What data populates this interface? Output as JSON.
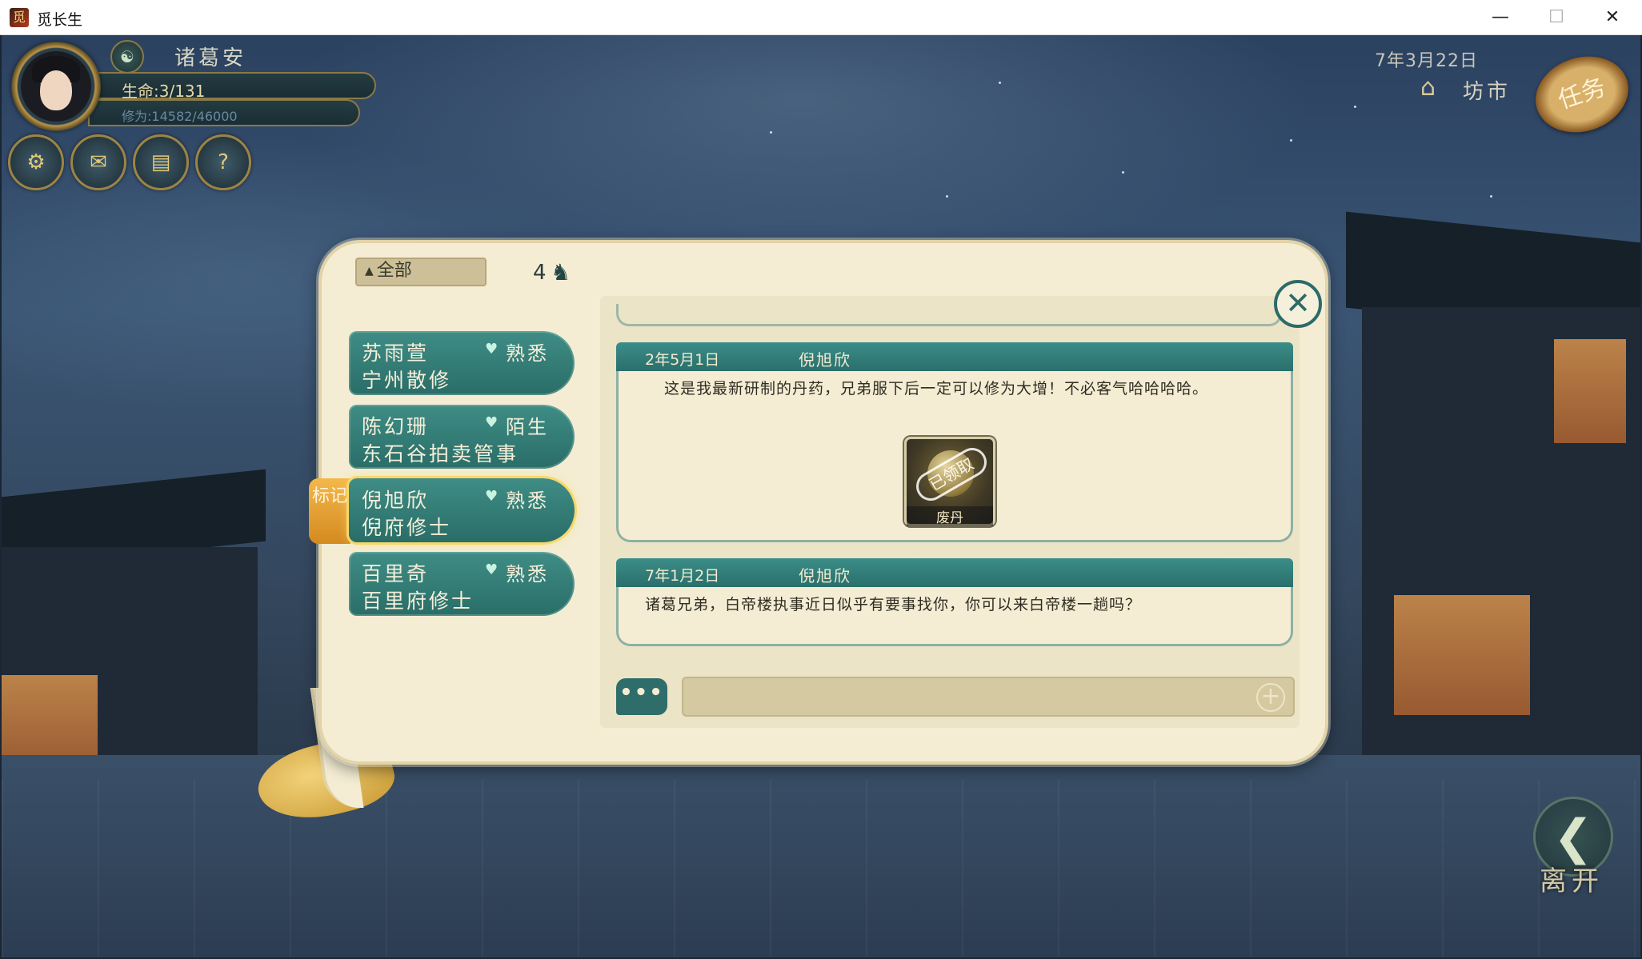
{
  "window": {
    "title": "觅长生",
    "app_icon_glyph": "觅",
    "minimize": "—",
    "maximize": "☐",
    "close": "✕"
  },
  "hud": {
    "player_name": "诸葛安",
    "dao_icon": "☯",
    "life_label": "生命",
    "life_value": ":3/131",
    "cultivation_label": "修为",
    "cultivation_value": ":14582/46000",
    "menu_icons": [
      "compass-icon",
      "scroll-icon",
      "map-icon",
      "hint-icon"
    ],
    "menu_glyphs": [
      "⚙",
      "✉",
      "▤",
      "?"
    ]
  },
  "top_right": {
    "date": "7年3月22日",
    "location_icon": "⌂",
    "location": "坊市",
    "task_button": "任务"
  },
  "leave": {
    "icon": "❮",
    "label": "离开"
  },
  "dialog": {
    "filter_label": "全部",
    "filter_arrow": "▲",
    "friend_count": "4",
    "friend_icon": "♞",
    "mark_tab": "标记",
    "close_glyph": "✕",
    "contacts": [
      {
        "name": "苏雨萱",
        "title": "宁州散修",
        "relation": "熟悉",
        "heart": "♥"
      },
      {
        "name": "陈幻珊",
        "title": "东石谷拍卖管事",
        "relation": "陌生",
        "heart": "♥"
      },
      {
        "name": "倪旭欣",
        "title": "倪府修士",
        "relation": "熟悉",
        "heart": "♥"
      },
      {
        "name": "百里奇",
        "title": "百里府修士",
        "relation": "熟悉",
        "heart": "♥"
      }
    ],
    "messages": [
      {
        "date": "2年5月1日",
        "sender": "倪旭欣",
        "text": "这是我最新研制的丹药，兄弟服下后一定可以修为大增！不必客气哈哈哈哈。",
        "gift": {
          "name": "废丹",
          "stamp": "已领取"
        }
      },
      {
        "date": "7年1月2日",
        "sender": "倪旭欣",
        "text": "诸葛兄弟，白帝楼执事近日似乎有要事找你，你可以来白帝楼一趟吗？"
      }
    ],
    "chat": {
      "icon_glyph": "•••",
      "placeholder": "",
      "plus": "+"
    }
  }
}
